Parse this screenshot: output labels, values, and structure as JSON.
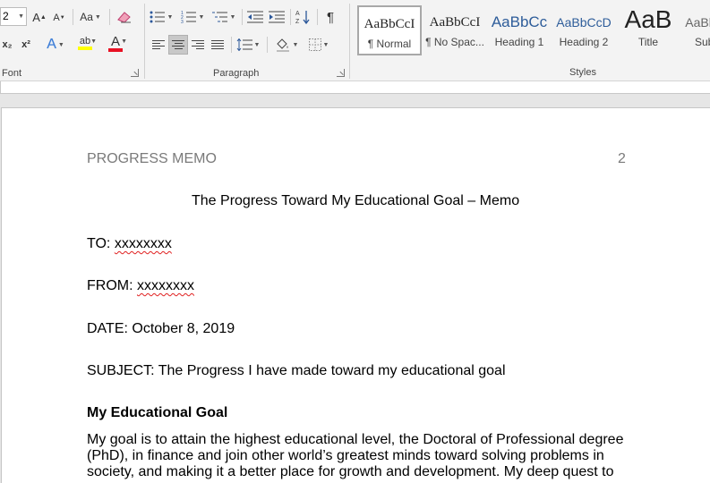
{
  "ribbon": {
    "font": {
      "size_value": "2",
      "case_label": "Aa",
      "group_label": "Font",
      "grow_label": "A",
      "shrink_label": "A",
      "subscript_label": "x₂",
      "superscript_label": "x²",
      "text_effects_label": "A",
      "highlight_label": "ab",
      "font_color_label": "A",
      "highlight_color": "#ffff00",
      "font_color": "#e81123"
    },
    "paragraph": {
      "group_label": "Paragraph",
      "pilcrow": "¶",
      "sort_label": "A↓Z"
    },
    "styles": {
      "group_label": "Styles",
      "items": [
        {
          "sample": "AaBbCcI",
          "name": "¶ Normal"
        },
        {
          "sample": "AaBbCcI",
          "name": "¶ No Spac..."
        },
        {
          "sample": "AaBbCc",
          "name": "Heading 1"
        },
        {
          "sample": "AaBbCcD",
          "name": "Heading 2"
        },
        {
          "sample": "AaB",
          "name": "Title"
        },
        {
          "sample": "AaBbCcD",
          "name": "Subtitle"
        }
      ]
    }
  },
  "document": {
    "header_left": "PROGRESS MEMO",
    "header_right": "2",
    "title": "The Progress Toward My Educational Goal – Memo",
    "to_label": "TO: ",
    "to_value": "xxxxxxxx",
    "from_label": "FROM: ",
    "from_value": "xxxxxxxx",
    "date_line": "DATE: October 8, 2019",
    "subject_line": "SUBJECT: The Progress I have made toward my educational goal",
    "section_heading": "My Educational Goal",
    "body": "My goal is to attain the highest educational level, the Doctoral of Professional degree (PhD), in finance and join other world’s greatest minds toward solving problems in society, and making it a better place for growth and development. My deep quest to"
  }
}
